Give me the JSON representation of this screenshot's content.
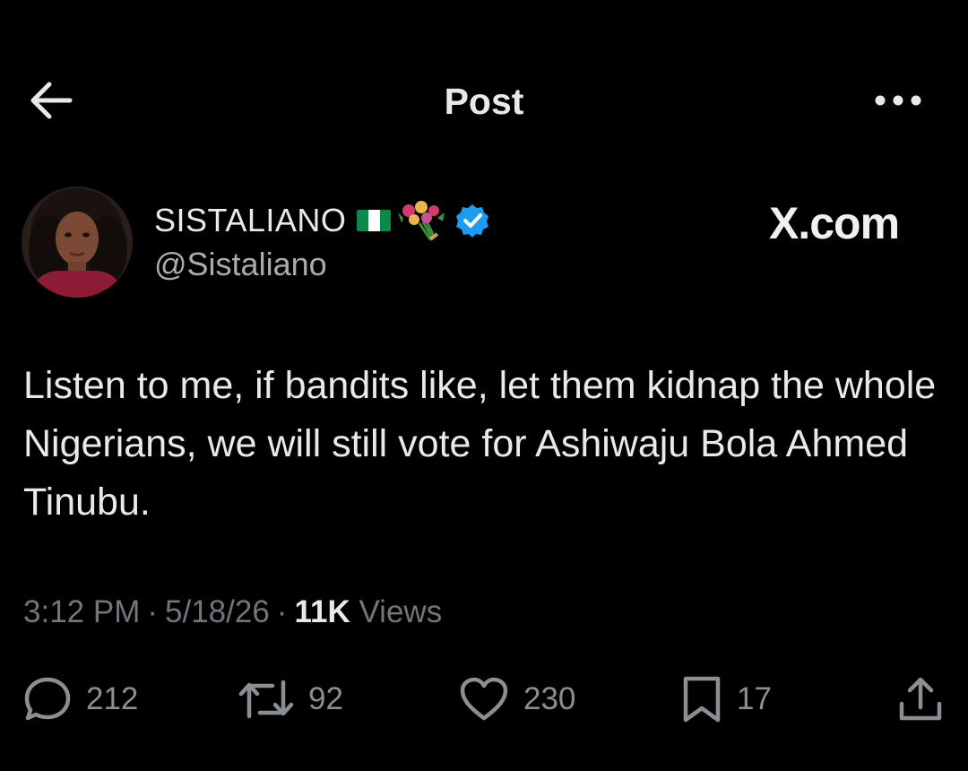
{
  "header": {
    "title": "Post",
    "back_icon": "arrow-left-icon",
    "more_icon": "more-horizontal-icon"
  },
  "author": {
    "display_name": "SISTALIANO",
    "handle": "@Sistaliano",
    "badges": [
      "nigeria-flag-icon",
      "bouquet-icon",
      "verified-badge-icon"
    ],
    "verified_color": "#1d9bf0"
  },
  "watermark": "X.com",
  "post": {
    "text": "Listen to me, if bandits like, let them kidnap the whole Nigerians, we will still vote for Ashiwaju Bola Ahmed Tinubu.",
    "time": "3:12 PM",
    "date": "5/18/26",
    "views_count": "11K",
    "views_label": "Views",
    "separator": "·"
  },
  "actions": {
    "replies": "212",
    "reposts": "92",
    "likes": "230",
    "bookmarks": "17"
  },
  "colors": {
    "background": "#000000",
    "text": "#e7e9ea",
    "secondary": "#71767b"
  }
}
